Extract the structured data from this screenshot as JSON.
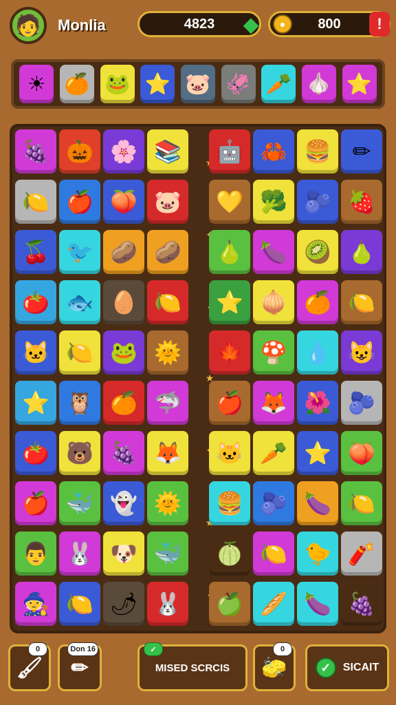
{
  "hud": {
    "player_name": "Monlia",
    "avatar_icon": "avatar-face-icon",
    "score": "4823",
    "coins": "800",
    "plus_label": "!"
  },
  "goals": [
    {
      "icon": "sun-icon",
      "glyph": "☀",
      "color": "#d13ad6"
    },
    {
      "icon": "flame-fruit-icon",
      "glyph": "🍊",
      "color": "#b6b6b6"
    },
    {
      "icon": "green-blob-icon",
      "glyph": "🐸",
      "color": "#f0e23a"
    },
    {
      "icon": "yellow-star-icon",
      "glyph": "⭐",
      "color": "#3b5ad6"
    },
    {
      "icon": "pink-creature-icon",
      "glyph": "🐷",
      "color": "#536d84"
    },
    {
      "icon": "red-creature-icon",
      "glyph": "🦑",
      "color": "#7a7d7a"
    },
    {
      "icon": "orange-candy-icon",
      "glyph": "🥕",
      "color": "#35d6e0"
    },
    {
      "icon": "garlic-icon",
      "glyph": "🧄",
      "color": "#d13ad6"
    },
    {
      "icon": "star-icon",
      "glyph": "⭐",
      "color": "#d13ad6"
    }
  ],
  "board": {
    "rows": [
      [
        {
          "g": "🍇",
          "c": "#d13ad6"
        },
        {
          "g": "🎃",
          "c": "#e0402a"
        },
        {
          "g": "🌸",
          "c": "#7a3ad6"
        },
        {
          "g": "📚",
          "c": "#f0e23a"
        },
        null,
        {
          "g": "🤖",
          "c": "#d62a2a"
        },
        {
          "g": "🦀",
          "c": "#3b5ad6"
        },
        {
          "g": "🍔",
          "c": "#f0e23a"
        },
        {
          "g": "✏",
          "c": "#3b5ad6"
        }
      ],
      [
        {
          "g": "🍋",
          "c": "#b6b6b6"
        },
        {
          "g": "🍎",
          "c": "#2f7ae0"
        },
        {
          "g": "🍑",
          "c": "#3b5ad6"
        },
        {
          "g": "🐷",
          "c": "#d62a2a"
        },
        null,
        {
          "g": "💛",
          "c": "#a86a2e"
        },
        {
          "g": "🥦",
          "c": "#f0e23a"
        },
        {
          "g": "🫐",
          "c": "#3b5ad6"
        },
        {
          "g": "🍓",
          "c": "#a86a2e"
        }
      ],
      [
        {
          "g": "🍒",
          "c": "#3b5ad6"
        },
        {
          "g": "🐦",
          "c": "#35d6e0"
        },
        {
          "g": "🥔",
          "c": "#f0a020"
        },
        {
          "g": "🥔",
          "c": "#f0a020"
        },
        null,
        {
          "g": "🍐",
          "c": "#5ac040"
        },
        {
          "g": "🍆",
          "c": "#d13ad6"
        },
        {
          "g": "🥝",
          "c": "#f0e23a"
        },
        {
          "g": "🍐",
          "c": "#7a3ad6"
        }
      ],
      [
        {
          "g": "🍅",
          "c": "#35a6e0"
        },
        {
          "g": "🐟",
          "c": "#35d6e0"
        },
        {
          "g": "🥚",
          "c": "#5a4a3a"
        },
        {
          "g": "🍋",
          "c": "#d62a2a"
        },
        null,
        {
          "g": "⭐",
          "c": "#3aa040"
        },
        {
          "g": "🧅",
          "c": "#f0e23a"
        },
        {
          "g": "🍊",
          "c": "#d13ad6"
        },
        {
          "g": "🍋",
          "c": "#a86a2e"
        }
      ],
      [
        {
          "g": "🐱",
          "c": "#3b5ad6"
        },
        {
          "g": "🍋",
          "c": "#f0e23a"
        },
        {
          "g": "🐸",
          "c": "#7a3ad6"
        },
        {
          "g": "🌞",
          "c": "#a86a2e"
        },
        null,
        {
          "g": "🍁",
          "c": "#d62a2a"
        },
        {
          "g": "🍄",
          "c": "#5ac040"
        },
        {
          "g": "💧",
          "c": "#35d6e0"
        },
        {
          "g": "😺",
          "c": "#7a3ad6"
        }
      ],
      [
        {
          "g": "⭐",
          "c": "#35a6e0"
        },
        {
          "g": "🦉",
          "c": "#2f7ae0"
        },
        {
          "g": "🍊",
          "c": "#d62a2a"
        },
        {
          "g": "🦈",
          "c": "#d13ad6"
        },
        null,
        {
          "g": "🍎",
          "c": "#a86a2e"
        },
        {
          "g": "🦊",
          "c": "#d13ad6"
        },
        {
          "g": "🌺",
          "c": "#3b5ad6"
        },
        {
          "g": "🫐",
          "c": "#b6b6b6"
        }
      ],
      [
        {
          "g": "🍅",
          "c": "#3b5ad6"
        },
        {
          "g": "🐻",
          "c": "#f0e23a"
        },
        {
          "g": "🍇",
          "c": "#d13ad6"
        },
        {
          "g": "🦊",
          "c": "#f0e23a"
        },
        null,
        {
          "g": "🐱",
          "c": "#f0e23a"
        },
        {
          "g": "🥕",
          "c": "#f0e23a"
        },
        {
          "g": "⭐",
          "c": "#3b5ad6"
        },
        {
          "g": "🍑",
          "c": "#5ac040"
        }
      ],
      [
        {
          "g": "🍎",
          "c": "#d13ad6"
        },
        {
          "g": "🐳",
          "c": "#5ac040"
        },
        {
          "g": "👻",
          "c": "#3b5ad6"
        },
        {
          "g": "🌞",
          "c": "#5ac040"
        },
        null,
        {
          "g": "🍔",
          "c": "#35d6e0"
        },
        {
          "g": "🫐",
          "c": "#2f7ae0"
        },
        {
          "g": "🍆",
          "c": "#f0a020"
        },
        {
          "g": "🍋",
          "c": "#5ac040"
        }
      ],
      [
        {
          "g": "👨",
          "c": "#5ac040"
        },
        {
          "g": "🐰",
          "c": "#d13ad6"
        },
        {
          "g": "🐶",
          "c": "#f0e23a"
        },
        {
          "g": "🐳",
          "c": "#5ac040"
        },
        null,
        {
          "g": "🍈",
          "c": "#4a2c14"
        },
        {
          "g": "🍋",
          "c": "#d13ad6"
        },
        {
          "g": "🐤",
          "c": "#35d6e0"
        },
        {
          "g": "🧨",
          "c": "#b6b6b6"
        }
      ],
      [
        {
          "g": "🧙",
          "c": "#d13ad6"
        },
        {
          "g": "🍋",
          "c": "#3b5ad6"
        },
        {
          "g": "🌶",
          "c": "#5a4a3a"
        },
        {
          "g": "🐰",
          "c": "#d62a2a"
        },
        null,
        {
          "g": "🍏",
          "c": "#a86a2e"
        },
        {
          "g": "🥖",
          "c": "#35d6e0"
        },
        {
          "g": "🍆",
          "c": "#35d6e0"
        },
        {
          "g": "🍇",
          "c": "#4a2c14"
        }
      ]
    ]
  },
  "bottom": {
    "paint_badge": "0",
    "pencil_badge": "Don 16",
    "missed_label": "MISED SCRCIS",
    "brush_badge": "0",
    "start_label": "SICAIT"
  }
}
